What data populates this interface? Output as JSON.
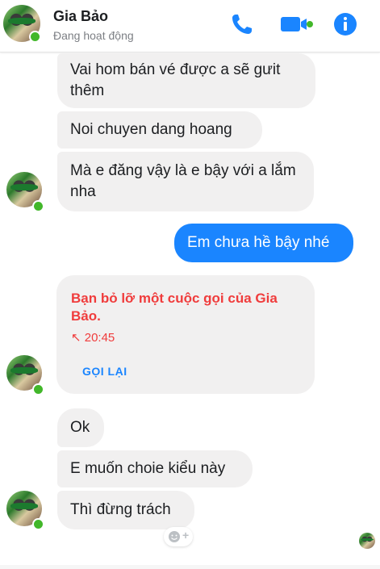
{
  "header": {
    "name": "Gia Bảo",
    "status": "Đang hoạt động",
    "accent": "#1a85ff",
    "online_color": "#42b72a",
    "icons": [
      "phone-icon",
      "video-call-icon",
      "info-icon"
    ]
  },
  "messages": [
    {
      "text": "Vai hom bán vé được a sẽ gưit thêm",
      "direction": "incoming"
    },
    {
      "text": "Noi chuyen dang hoang",
      "direction": "incoming"
    },
    {
      "text": "Mà e đăng vậy là e bậy với a lắm nha",
      "direction": "incoming"
    },
    {
      "text": "Em chưa hề bậy nhé",
      "direction": "outgoing"
    },
    {
      "text": "Ok",
      "direction": "incoming"
    },
    {
      "text": "E muốn choie kiểu này",
      "direction": "incoming"
    },
    {
      "text": "Thì đừng trách",
      "direction": "incoming"
    }
  ],
  "missed_call": {
    "title": "Bạn bỏ lỡ một cuộc gọi của Gia Bảo.",
    "time": "↖ 20:45",
    "action_label": "GỌI LẠI",
    "color": "#f03c3c"
  },
  "reaction_button": {
    "icon": "add-reaction-icon",
    "plus": "+"
  }
}
